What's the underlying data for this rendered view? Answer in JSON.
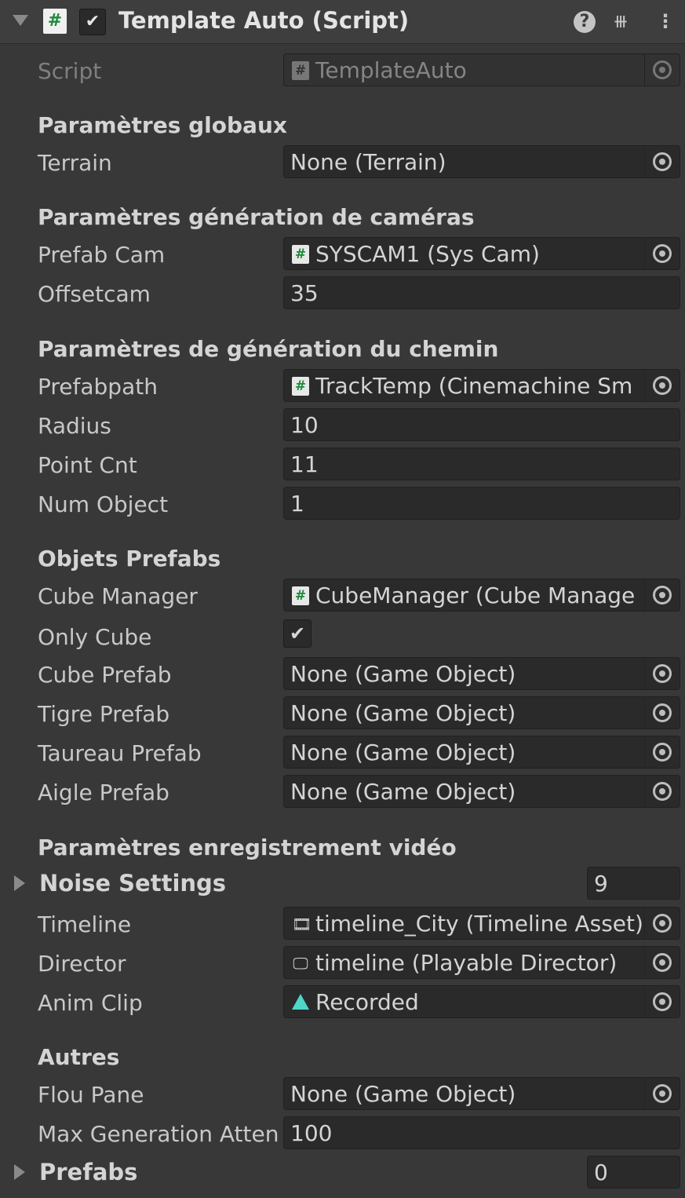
{
  "header": {
    "title": "Template Auto (Script)",
    "script_icon": "#",
    "enabled_check": "✔",
    "help_icon": "?",
    "presets_icon": "⧻",
    "menu_icon": "⋮"
  },
  "script_row": {
    "label": "Script",
    "value": "TemplateAuto",
    "icon": "#"
  },
  "sections": {
    "global": "Paramètres globaux",
    "cameras": "Paramètres génération de caméras",
    "path": "Paramètres de génération du chemin",
    "objects": "Objets Prefabs",
    "video": "Paramètres enregistrement vidéo",
    "others": "Autres"
  },
  "fields": {
    "terrain": {
      "label": "Terrain",
      "value": "None (Terrain)"
    },
    "prefab_cam": {
      "label": "Prefab Cam",
      "value": "SYSCAM1 (Sys Cam)",
      "icon": "#"
    },
    "offsetcam": {
      "label": "Offsetcam",
      "value": "35"
    },
    "prefabpath": {
      "label": "Prefabpath",
      "value": "TrackTemp (Cinemachine Sm",
      "icon": "#"
    },
    "radius": {
      "label": "Radius",
      "value": "10"
    },
    "point_cnt": {
      "label": "Point Cnt",
      "value": "11"
    },
    "num_object": {
      "label": "Num Object",
      "value": "1"
    },
    "cube_manager": {
      "label": "Cube Manager",
      "value": "CubeManager (Cube Manage",
      "icon": "#"
    },
    "only_cube": {
      "label": "Only Cube",
      "checked": "✔"
    },
    "cube_prefab": {
      "label": "Cube Prefab",
      "value": "None (Game Object)"
    },
    "tigre_prefab": {
      "label": "Tigre Prefab",
      "value": "None (Game Object)"
    },
    "taureau_prefab": {
      "label": "Taureau Prefab",
      "value": "None (Game Object)"
    },
    "aigle_prefab": {
      "label": "Aigle Prefab",
      "value": "None (Game Object)"
    },
    "noise_settings": {
      "label": "Noise Settings",
      "count": "9"
    },
    "timeline": {
      "label": "Timeline",
      "value": "timeline_City (Timeline Asset)",
      "icon": "🎞"
    },
    "director": {
      "label": "Director",
      "value": "timeline (Playable Director)",
      "icon": "🖵"
    },
    "anim_clip": {
      "label": "Anim Clip",
      "value": "Recorded"
    },
    "flou_pane": {
      "label": "Flou Pane",
      "value": "None (Game Object)"
    },
    "max_generation": {
      "label": "Max Generation Atten",
      "value": "100"
    },
    "prefabs": {
      "label": "Prefabs",
      "count": "0"
    }
  },
  "colors": {
    "background": "#383838",
    "field": "#2a2a2a",
    "accent_anim": "#4fd6c8",
    "script_green": "#1c8a3a"
  }
}
